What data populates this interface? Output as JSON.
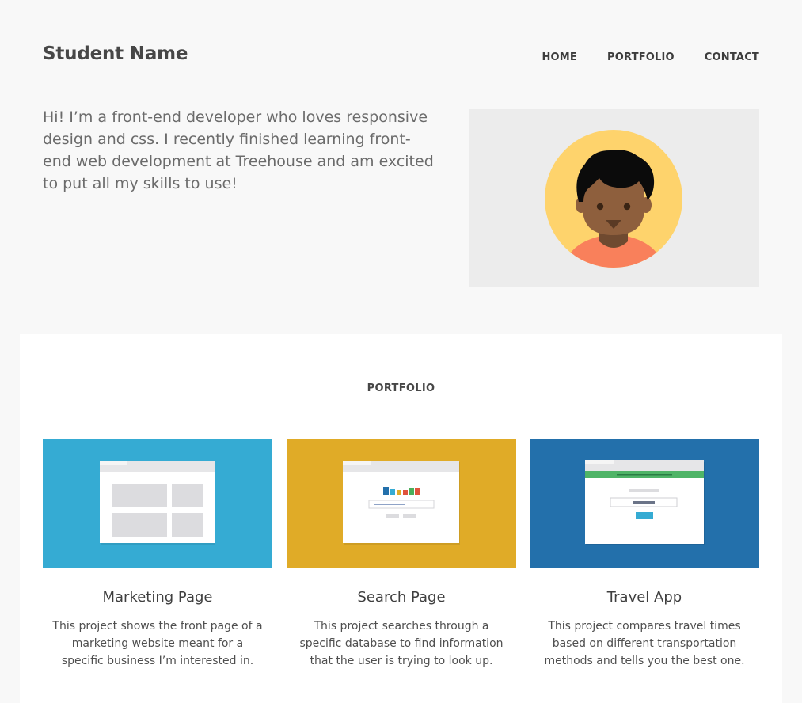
{
  "header": {
    "title": "Student Name",
    "nav": [
      {
        "label": "HOME"
      },
      {
        "label": "PORTFOLIO"
      },
      {
        "label": "CONTACT"
      }
    ]
  },
  "intro": {
    "text": "Hi! I’m a front-end developer who loves responsive design and css. I recently finished learning front-end web development at Treehouse and am excited to put all my skills to use!"
  },
  "portfolio": {
    "heading": "PORTFOLIO",
    "projects": [
      {
        "title": "Marketing Page",
        "description": "This project shows the front page of a marketing website meant for a specific business I’m interested in.",
        "color": "#35abd3"
      },
      {
        "title": "Search Page",
        "description": "This project searches through a specific database to find information that the user is trying to look up.",
        "color": "#e0ab27"
      },
      {
        "title": "Travel App",
        "description": "This project compares travel times based on different transportation methods and tells you the best one.",
        "color": "#2370ab"
      }
    ]
  },
  "colors": {
    "background": "#f8f8f8",
    "avatar_panel": "#ececec",
    "avatar_circle": "#fed36c",
    "avatar_skin": "#8e5f3d",
    "avatar_shirt": "#f9805b"
  }
}
